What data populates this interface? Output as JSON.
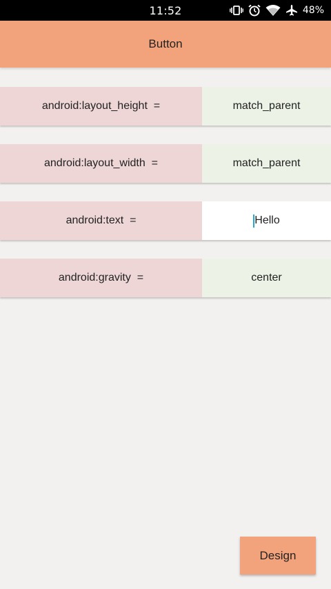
{
  "status_bar": {
    "time": "11:52",
    "battery": "48%",
    "icons": [
      "vibrate-icon",
      "alarm-icon",
      "wifi-icon",
      "airplane-icon"
    ]
  },
  "appbar": {
    "title": "Button",
    "color": "#f2a37c"
  },
  "properties": [
    {
      "label": "android:layout_height  =",
      "value": "match_parent"
    },
    {
      "label": "android:layout_width  =",
      "value": "match_parent"
    },
    {
      "label": "android:text  =",
      "value": "Hello",
      "focused": true
    },
    {
      "label": "android:gravity  =",
      "value": "center"
    }
  ],
  "design_button": {
    "label": "Design"
  },
  "colors": {
    "label_bg": "#efd6d6",
    "value_bg": "#ecf3e6",
    "background": "#f3f1ef",
    "cursor": "#29a7c9"
  }
}
